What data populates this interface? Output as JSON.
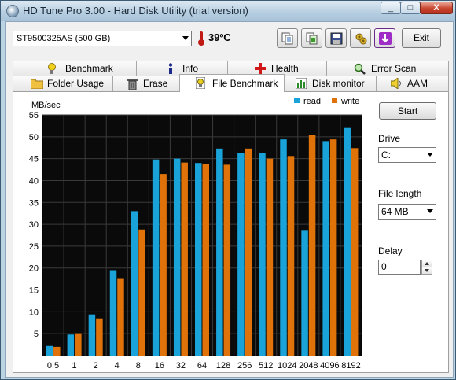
{
  "window": {
    "title": "HD Tune Pro 3.00 - Hard Disk Utility (trial version)",
    "buttons": {
      "minimize": "_",
      "maximize": "□",
      "close": "X"
    }
  },
  "toolbar": {
    "disk": "ST9500325AS (500 GB)",
    "temperature": "39ºC",
    "exit_label": "Exit",
    "icons": [
      "copy-info-icon",
      "copy-screen-icon",
      "save-icon",
      "options-icon",
      "download-icon"
    ]
  },
  "tabs": {
    "row1": [
      "Benchmark",
      "Info",
      "Health",
      "Error Scan"
    ],
    "row2": [
      "Folder Usage",
      "Erase",
      "File Benchmark",
      "Disk monitor",
      "AAM"
    ],
    "active": "File Benchmark"
  },
  "controls": {
    "start_label": "Start",
    "drive_label": "Drive",
    "drive_value": "C:",
    "file_length_label": "File length",
    "file_length_value": "64 MB",
    "delay_label": "Delay",
    "delay_value": "0"
  },
  "colors": {
    "read": "#19a3d9",
    "write": "#e0720a",
    "plot_bg": "#0a0a0a",
    "grid": "#3a3a3a"
  },
  "chart_data": {
    "type": "bar",
    "ylabel": "MB/sec",
    "ylim": [
      0,
      55
    ],
    "yticks": [
      5,
      10,
      15,
      20,
      25,
      30,
      35,
      40,
      45,
      50,
      55
    ],
    "categories": [
      "0.5",
      "1",
      "2",
      "4",
      "8",
      "16",
      "32",
      "64",
      "128",
      "256",
      "512",
      "1024",
      "2048",
      "4096",
      "8192"
    ],
    "series": [
      {
        "name": "read",
        "values": [
          2.2,
          4.8,
          9.4,
          19.5,
          33.0,
          44.8,
          45.0,
          44.0,
          47.3,
          46.2,
          46.2,
          49.4,
          28.7,
          49.0,
          52.0
        ]
      },
      {
        "name": "write",
        "values": [
          2.0,
          5.1,
          8.5,
          17.7,
          28.8,
          41.5,
          44.1,
          43.8,
          43.6,
          47.3,
          45.0,
          45.6,
          50.4,
          49.4,
          47.4
        ]
      }
    ],
    "legend_position": "top-right",
    "grid": true
  }
}
